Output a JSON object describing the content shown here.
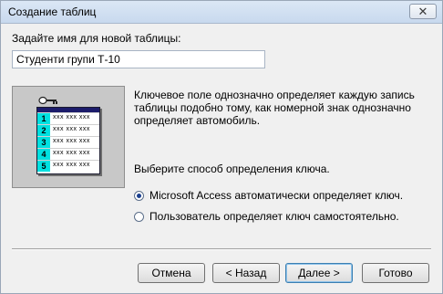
{
  "window": {
    "title": "Создание таблиц",
    "close_label": "✕"
  },
  "prompt": {
    "label": "Задайте имя для новой таблицы:",
    "value": "Студенти групи Т-10"
  },
  "illustration": {
    "rows": [
      {
        "num": "1",
        "cells": "xxx xxx xxx"
      },
      {
        "num": "2",
        "cells": "xxx xxx xxx"
      },
      {
        "num": "3",
        "cells": "xxx xxx xxx"
      },
      {
        "num": "4",
        "cells": "xxx xxx xxx"
      },
      {
        "num": "5",
        "cells": "xxx xxx xxx"
      }
    ]
  },
  "description": {
    "line1": "Ключевое поле однозначно определяет каждую запись",
    "line2": "таблицы подобно тому, как номерной знак однозначно",
    "line3": "определяет автомобиль."
  },
  "key_method": {
    "label": "Выберите способ определения ключа.",
    "options": [
      {
        "label": "Microsoft Access автоматически определяет ключ.",
        "checked": true
      },
      {
        "label": "Пользователь определяет ключ самостоятельно.",
        "checked": false
      }
    ]
  },
  "buttons": {
    "cancel": "Отмена",
    "back": "< Назад",
    "next": "Далее >",
    "finish": "Готово"
  }
}
